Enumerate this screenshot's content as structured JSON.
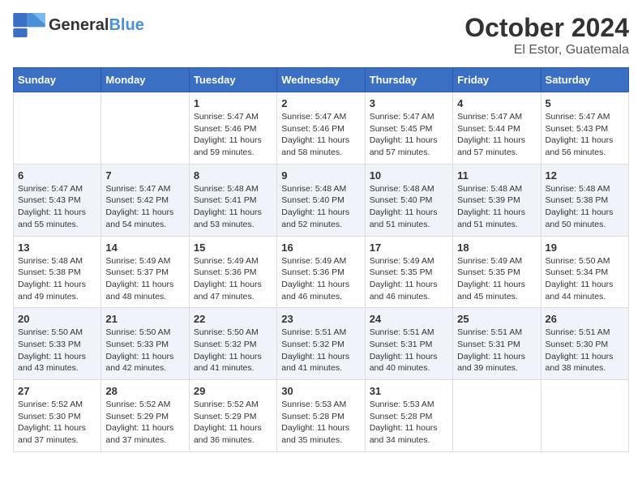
{
  "logo": {
    "general": "General",
    "blue": "Blue",
    "tagline": ""
  },
  "title": "October 2024",
  "subtitle": "El Estor, Guatemala",
  "days_header": [
    "Sunday",
    "Monday",
    "Tuesday",
    "Wednesday",
    "Thursday",
    "Friday",
    "Saturday"
  ],
  "weeks": [
    [
      {
        "num": "",
        "info": ""
      },
      {
        "num": "",
        "info": ""
      },
      {
        "num": "1",
        "info": "Sunrise: 5:47 AM\nSunset: 5:46 PM\nDaylight: 11 hours and 59 minutes."
      },
      {
        "num": "2",
        "info": "Sunrise: 5:47 AM\nSunset: 5:46 PM\nDaylight: 11 hours and 58 minutes."
      },
      {
        "num": "3",
        "info": "Sunrise: 5:47 AM\nSunset: 5:45 PM\nDaylight: 11 hours and 57 minutes."
      },
      {
        "num": "4",
        "info": "Sunrise: 5:47 AM\nSunset: 5:44 PM\nDaylight: 11 hours and 57 minutes."
      },
      {
        "num": "5",
        "info": "Sunrise: 5:47 AM\nSunset: 5:43 PM\nDaylight: 11 hours and 56 minutes."
      }
    ],
    [
      {
        "num": "6",
        "info": "Sunrise: 5:47 AM\nSunset: 5:43 PM\nDaylight: 11 hours and 55 minutes."
      },
      {
        "num": "7",
        "info": "Sunrise: 5:47 AM\nSunset: 5:42 PM\nDaylight: 11 hours and 54 minutes."
      },
      {
        "num": "8",
        "info": "Sunrise: 5:48 AM\nSunset: 5:41 PM\nDaylight: 11 hours and 53 minutes."
      },
      {
        "num": "9",
        "info": "Sunrise: 5:48 AM\nSunset: 5:40 PM\nDaylight: 11 hours and 52 minutes."
      },
      {
        "num": "10",
        "info": "Sunrise: 5:48 AM\nSunset: 5:40 PM\nDaylight: 11 hours and 51 minutes."
      },
      {
        "num": "11",
        "info": "Sunrise: 5:48 AM\nSunset: 5:39 PM\nDaylight: 11 hours and 51 minutes."
      },
      {
        "num": "12",
        "info": "Sunrise: 5:48 AM\nSunset: 5:38 PM\nDaylight: 11 hours and 50 minutes."
      }
    ],
    [
      {
        "num": "13",
        "info": "Sunrise: 5:48 AM\nSunset: 5:38 PM\nDaylight: 11 hours and 49 minutes."
      },
      {
        "num": "14",
        "info": "Sunrise: 5:49 AM\nSunset: 5:37 PM\nDaylight: 11 hours and 48 minutes."
      },
      {
        "num": "15",
        "info": "Sunrise: 5:49 AM\nSunset: 5:36 PM\nDaylight: 11 hours and 47 minutes."
      },
      {
        "num": "16",
        "info": "Sunrise: 5:49 AM\nSunset: 5:36 PM\nDaylight: 11 hours and 46 minutes."
      },
      {
        "num": "17",
        "info": "Sunrise: 5:49 AM\nSunset: 5:35 PM\nDaylight: 11 hours and 46 minutes."
      },
      {
        "num": "18",
        "info": "Sunrise: 5:49 AM\nSunset: 5:35 PM\nDaylight: 11 hours and 45 minutes."
      },
      {
        "num": "19",
        "info": "Sunrise: 5:50 AM\nSunset: 5:34 PM\nDaylight: 11 hours and 44 minutes."
      }
    ],
    [
      {
        "num": "20",
        "info": "Sunrise: 5:50 AM\nSunset: 5:33 PM\nDaylight: 11 hours and 43 minutes."
      },
      {
        "num": "21",
        "info": "Sunrise: 5:50 AM\nSunset: 5:33 PM\nDaylight: 11 hours and 42 minutes."
      },
      {
        "num": "22",
        "info": "Sunrise: 5:50 AM\nSunset: 5:32 PM\nDaylight: 11 hours and 41 minutes."
      },
      {
        "num": "23",
        "info": "Sunrise: 5:51 AM\nSunset: 5:32 PM\nDaylight: 11 hours and 41 minutes."
      },
      {
        "num": "24",
        "info": "Sunrise: 5:51 AM\nSunset: 5:31 PM\nDaylight: 11 hours and 40 minutes."
      },
      {
        "num": "25",
        "info": "Sunrise: 5:51 AM\nSunset: 5:31 PM\nDaylight: 11 hours and 39 minutes."
      },
      {
        "num": "26",
        "info": "Sunrise: 5:51 AM\nSunset: 5:30 PM\nDaylight: 11 hours and 38 minutes."
      }
    ],
    [
      {
        "num": "27",
        "info": "Sunrise: 5:52 AM\nSunset: 5:30 PM\nDaylight: 11 hours and 37 minutes."
      },
      {
        "num": "28",
        "info": "Sunrise: 5:52 AM\nSunset: 5:29 PM\nDaylight: 11 hours and 37 minutes."
      },
      {
        "num": "29",
        "info": "Sunrise: 5:52 AM\nSunset: 5:29 PM\nDaylight: 11 hours and 36 minutes."
      },
      {
        "num": "30",
        "info": "Sunrise: 5:53 AM\nSunset: 5:28 PM\nDaylight: 11 hours and 35 minutes."
      },
      {
        "num": "31",
        "info": "Sunrise: 5:53 AM\nSunset: 5:28 PM\nDaylight: 11 hours and 34 minutes."
      },
      {
        "num": "",
        "info": ""
      },
      {
        "num": "",
        "info": ""
      }
    ]
  ]
}
